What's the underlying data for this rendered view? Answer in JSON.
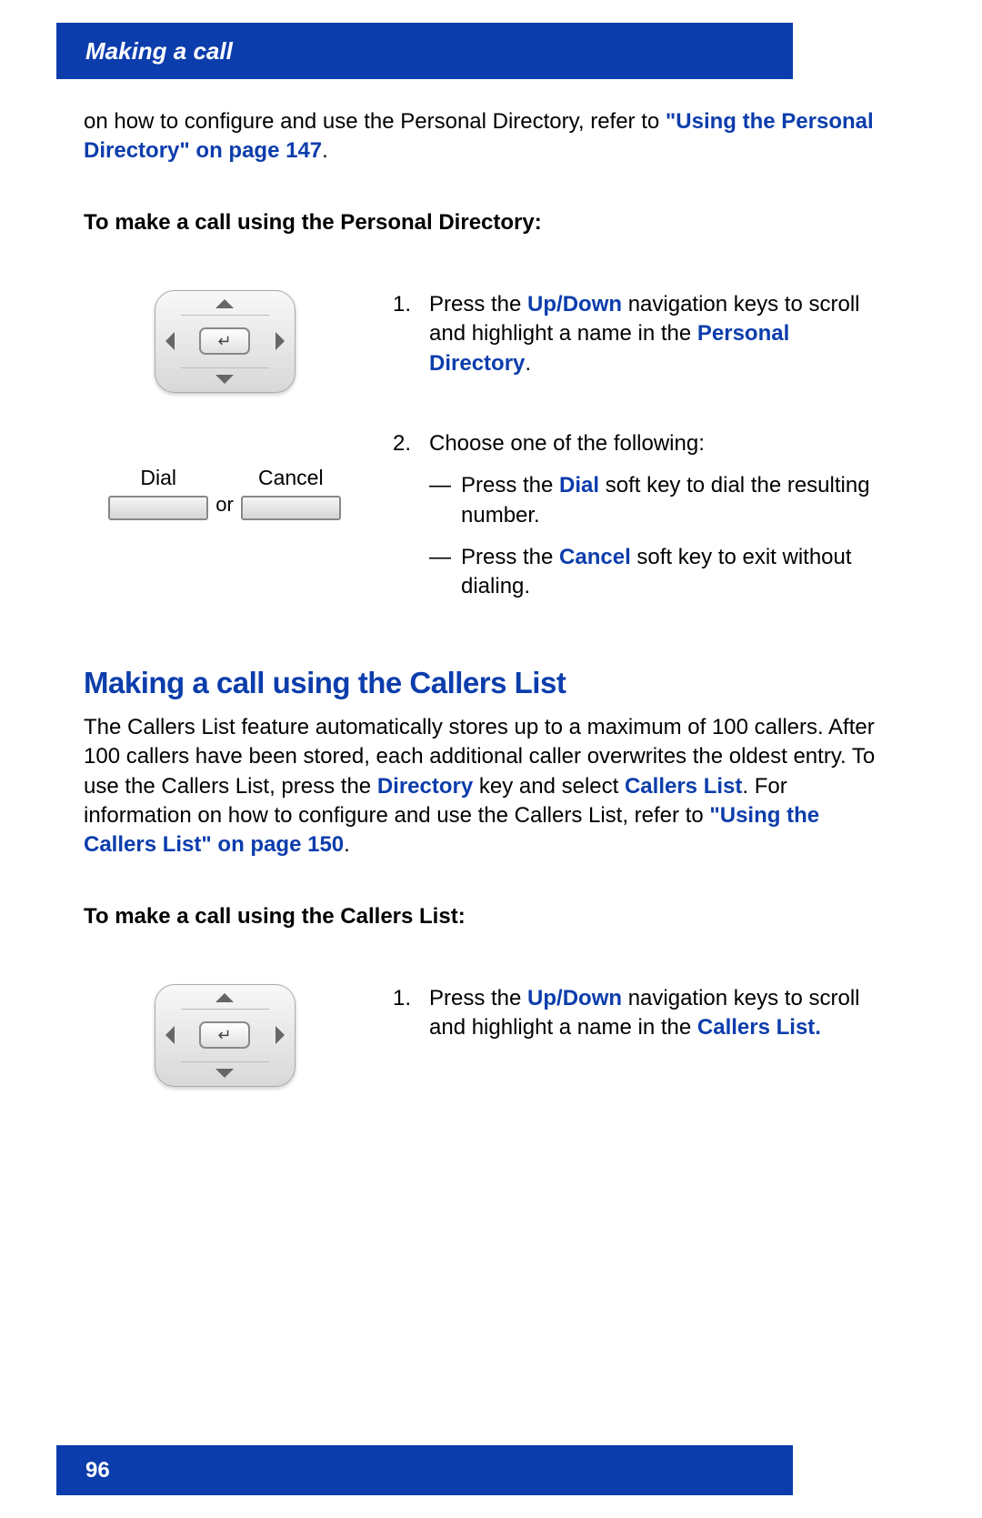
{
  "header": {
    "title": "Making a call"
  },
  "intro": {
    "text_pre": "on how to configure and use the Personal Directory, refer to ",
    "link": "\"Using the Personal Directory\" on page 147",
    "text_post": "."
  },
  "procedure1": {
    "heading": "To make a call using the Personal Directory:",
    "step1": {
      "num": "1.",
      "text_pre": "Press the ",
      "term1": "Up/Down",
      "text_mid": " navigation keys to scroll and highlight a name in the ",
      "term2": "Personal Directory",
      "text_post": "."
    },
    "step2": {
      "num": "2.",
      "text": "Choose one of the following:",
      "sub1_pre": "Press the ",
      "sub1_term": "Dial",
      "sub1_post": " soft key to dial the resulting number.",
      "sub2_pre": "Press the ",
      "sub2_term": "Cancel",
      "sub2_post": " soft key to exit without dialing."
    },
    "softkeys": {
      "dial": "Dial",
      "or": "or",
      "cancel": "Cancel"
    }
  },
  "section2": {
    "heading": "Making a call using the Callers List",
    "body_pre": "The Callers List feature automatically stores up to a maximum of 100 callers. After 100 callers have been stored, each additional caller overwrites the oldest entry. To use the Callers List, press the ",
    "term1": "Directory",
    "body_mid1": " key and select ",
    "term2": "Callers List",
    "body_mid2": ". For information on how to configure and use the Callers List, refer to ",
    "link": "\"Using the Callers List\" on page 150",
    "body_post": "."
  },
  "procedure2": {
    "heading": "To make a call using the Callers List:",
    "step1": {
      "num": "1.",
      "text_pre": "Press the ",
      "term1": "Up/Down",
      "text_mid": " navigation keys to scroll and highlight a name in the ",
      "term2": "Callers List.",
      "text_post": ""
    }
  },
  "footer": {
    "page": "96"
  }
}
